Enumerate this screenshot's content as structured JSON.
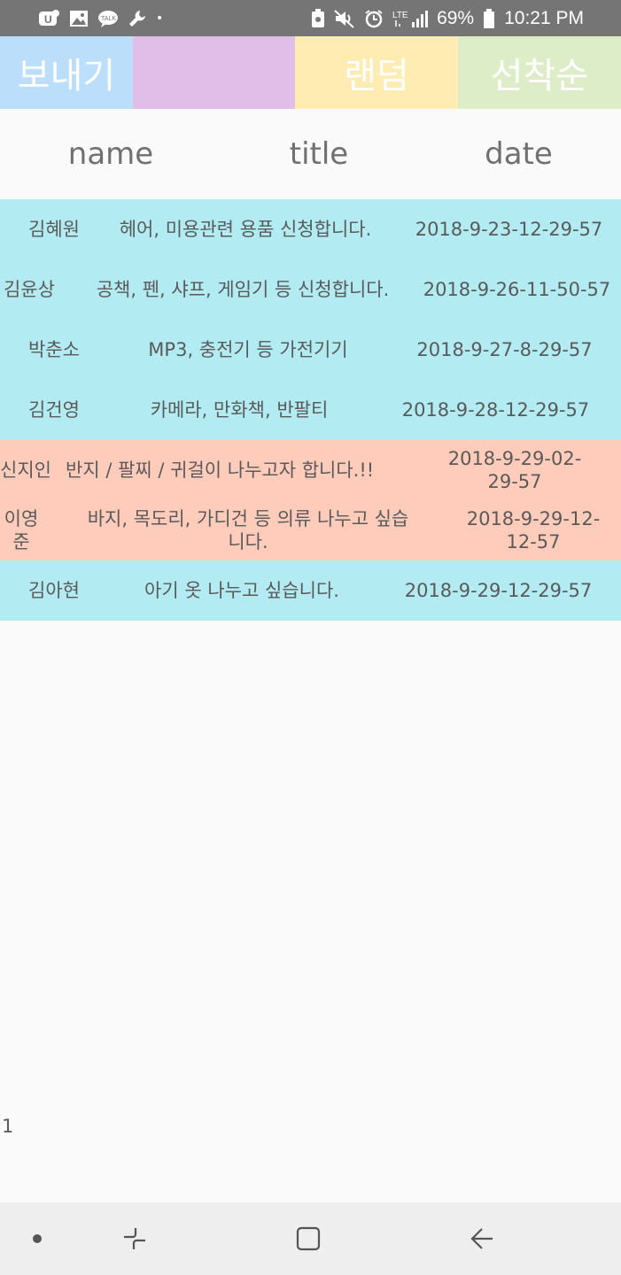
{
  "status_bar": {
    "battery": "69%",
    "time": "10:21 PM",
    "left_icons": [
      "app-notification-icon",
      "image-icon",
      "talk-icon",
      "wrench-icon"
    ],
    "right_icons": [
      "recycle-icon",
      "mute-icon",
      "alarm-icon",
      "lte-signal-icon",
      "battery-icon"
    ],
    "lte": "LTE",
    "dot": "•"
  },
  "tabs": {
    "send": "보내기",
    "blank": "",
    "random": "랜덤",
    "first_come": "선착순",
    "colors": {
      "send": "#bbdefb",
      "blank": "#e1bee7",
      "random": "#ffecb3",
      "first_come": "#dcedc8"
    }
  },
  "table": {
    "headers": {
      "name": "name",
      "title": "title",
      "date": "date"
    },
    "rows": [
      {
        "name": "김혜원",
        "title": "헤어, 미용관련 용품 신청합니다.",
        "date": "2018-9-23-12-29-57",
        "color": "blue"
      },
      {
        "name": "김윤상",
        "title": "공책, 펜, 샤프, 게임기 등 신청합니다.",
        "date": "2018-9-26-11-50-57",
        "color": "blue"
      },
      {
        "name": "박춘소",
        "title": "MP3, 충전기 등 가전기기",
        "date": "2018-9-27-8-29-57",
        "color": "blue"
      },
      {
        "name": "김건영",
        "title": "카메라, 만화책, 반팔티",
        "date": "2018-9-28-12-29-57",
        "color": "blue"
      },
      {
        "name": "신지인",
        "title": "반지 / 팔찌 / 귀걸이 나누고자 합니다.!!",
        "date": "2018-9-29-02-29-57",
        "color": "peach"
      },
      {
        "name": "이영준",
        "title": "바지, 목도리, 가디건 등 의류 나누고 싶습니다.",
        "date": "2018-9-29-12-12-57",
        "color": "peach"
      },
      {
        "name": "김아현",
        "title": "아기 옷 나누고 싶습니다.",
        "date": "2018-9-29-12-29-57",
        "color": "blue"
      }
    ],
    "row_colors": {
      "blue": "#b2ebf2",
      "peach": "#ffccbc"
    }
  },
  "page_number": "1",
  "nav_bar": {
    "icons": [
      "dot-icon",
      "recent-apps-icon",
      "home-icon",
      "back-icon"
    ]
  }
}
